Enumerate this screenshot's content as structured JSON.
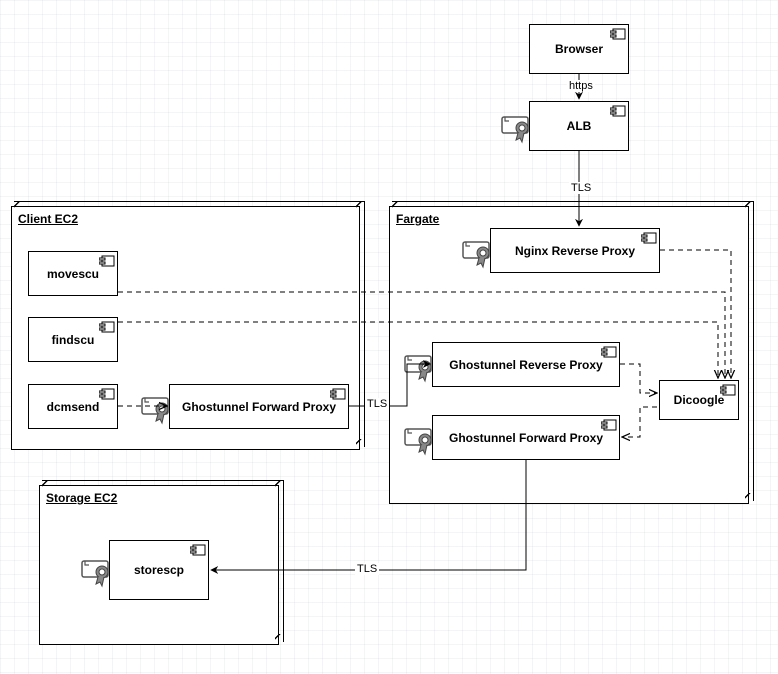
{
  "diagram": {
    "type": "uml-deployment",
    "groups": {
      "client": {
        "label": "Client EC2"
      },
      "fargate": {
        "label": "Fargate"
      },
      "storage": {
        "label": "Storage EC2"
      }
    },
    "components": {
      "browser": {
        "label": "Browser",
        "has_cert": false
      },
      "alb": {
        "label": "ALB",
        "has_cert": true
      },
      "movescu": {
        "label": "movescu",
        "has_cert": false
      },
      "findscu": {
        "label": "findscu",
        "has_cert": false
      },
      "dcmsend": {
        "label": "dcmsend",
        "has_cert": false
      },
      "gt_fwd_client": {
        "label": "Ghostunnel Forward Proxy",
        "has_cert": true
      },
      "nginx": {
        "label": "Nginx Reverse Proxy",
        "has_cert": true
      },
      "gt_rev": {
        "label": "Ghostunnel Reverse Proxy",
        "has_cert": true
      },
      "gt_fwd_fargate": {
        "label": "Ghostunnel Forward Proxy",
        "has_cert": true
      },
      "dicoogle": {
        "label": "Dicoogle",
        "has_cert": false
      },
      "storescp": {
        "label": "storescp",
        "has_cert": true
      }
    },
    "edges": [
      {
        "from": "browser",
        "to": "alb",
        "label": "https",
        "style": "solid"
      },
      {
        "from": "alb",
        "to": "nginx",
        "label": "TLS",
        "style": "solid"
      },
      {
        "from": "nginx",
        "to": "dicoogle",
        "label": null,
        "style": "dashed"
      },
      {
        "from": "movescu",
        "to": "dicoogle",
        "label": null,
        "style": "dashed"
      },
      {
        "from": "findscu",
        "to": "dicoogle",
        "label": null,
        "style": "dashed"
      },
      {
        "from": "dcmsend",
        "to": "gt_fwd_client",
        "label": null,
        "style": "dashed"
      },
      {
        "from": "gt_fwd_client",
        "to": "gt_rev",
        "label": "TLS",
        "style": "solid"
      },
      {
        "from": "gt_rev",
        "to": "dicoogle",
        "label": null,
        "style": "dashed"
      },
      {
        "from": "dicoogle",
        "to": "gt_fwd_fargate",
        "label": null,
        "style": "dashed"
      },
      {
        "from": "gt_fwd_fargate",
        "to": "storescp",
        "label": "TLS",
        "style": "solid"
      }
    ],
    "edge_labels": {
      "https": "https",
      "tls": "TLS"
    }
  }
}
